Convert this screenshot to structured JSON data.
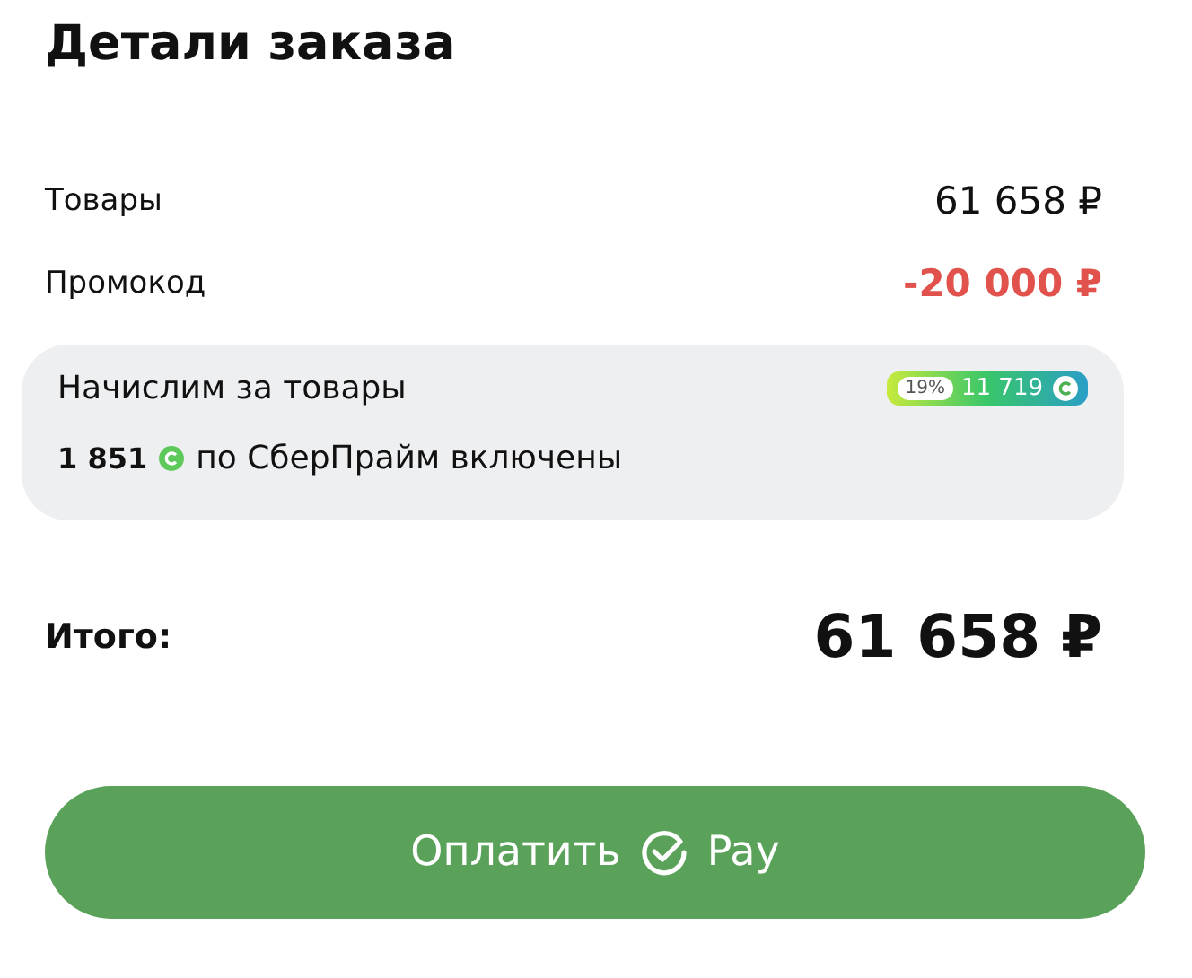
{
  "title": "Детали заказа",
  "rows": [
    {
      "label": "Товары",
      "value": "61 658 ₽",
      "kind": "normal"
    },
    {
      "label": "Промокод",
      "value": "-20 000 ₽",
      "kind": "discount"
    }
  ],
  "bonus": {
    "title": "Начислим за товары",
    "badge_percent": "19%",
    "badge_amount": "11 719",
    "prime_amount": "1 851",
    "prime_text": "по СберПрайм включены"
  },
  "total": {
    "label": "Итого:",
    "value": "61 658 ₽"
  },
  "pay_button": {
    "label": "Оплатить",
    "brand": "Pay"
  }
}
